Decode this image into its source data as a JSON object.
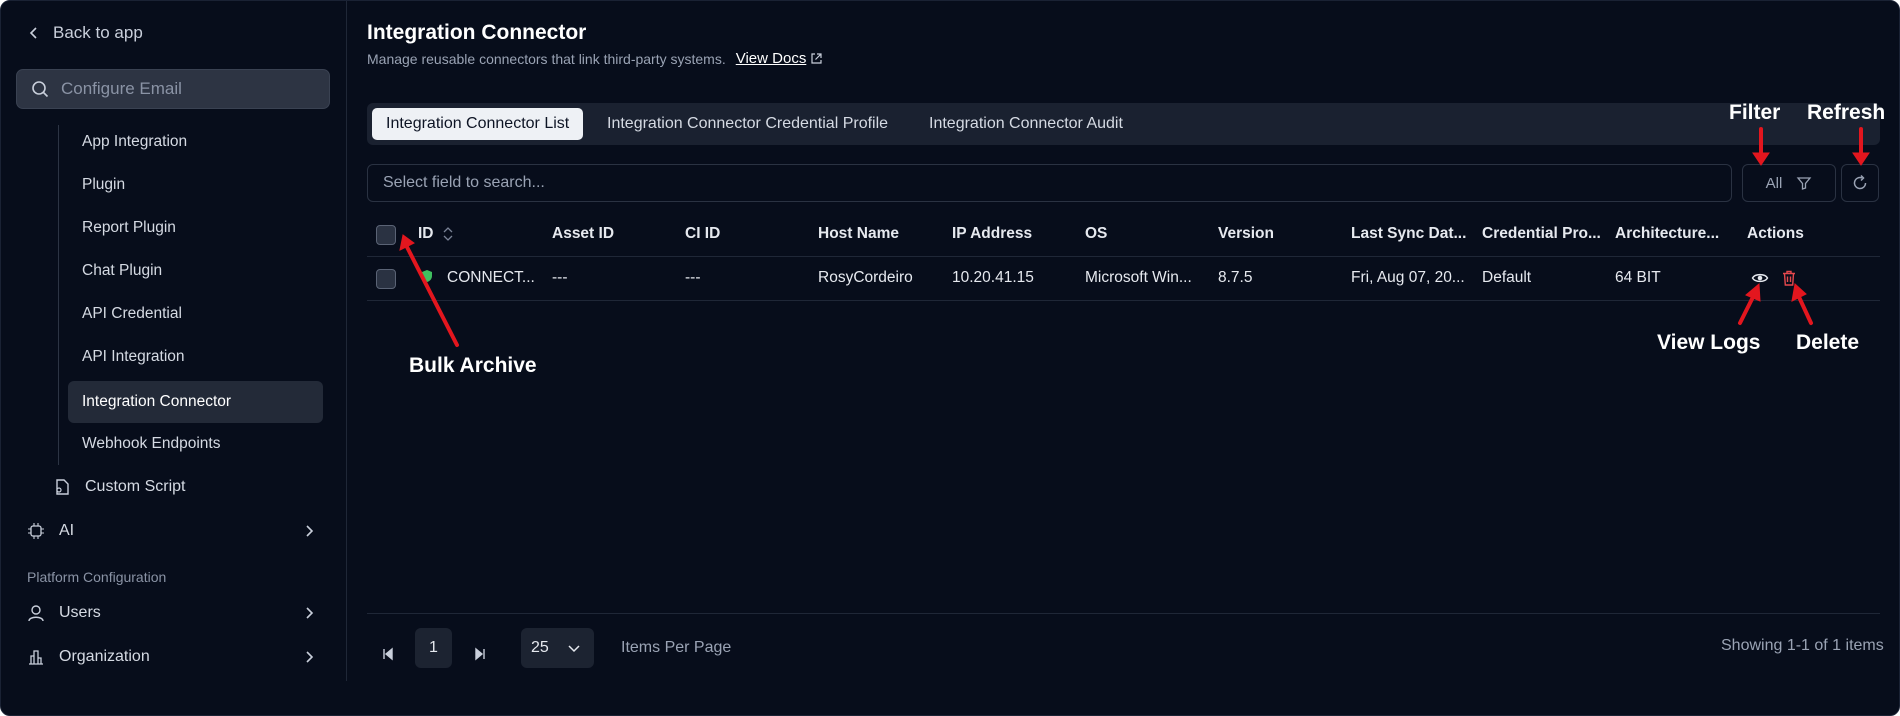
{
  "sidebar": {
    "back_label": "Back to app",
    "search_placeholder": "Configure Email",
    "sub_items": [
      "App Integration",
      "Plugin",
      "Report Plugin",
      "Chat Plugin",
      "API Credential",
      "API Integration",
      "Integration Connector",
      "Webhook Endpoints"
    ],
    "active_sub_item": "Integration Connector",
    "custom_script": "Custom Script",
    "ai": "AI",
    "section_label": "Platform Configuration",
    "users": "Users",
    "organization": "Organization"
  },
  "header": {
    "title": "Integration Connector",
    "subtitle": "Manage reusable connectors that link third-party systems.",
    "docs_link": "View Docs"
  },
  "tabs": [
    {
      "label": "Integration Connector List",
      "active": true
    },
    {
      "label": "Integration Connector Credential Profile",
      "active": false
    },
    {
      "label": "Integration Connector Audit",
      "active": false
    }
  ],
  "toolbar": {
    "search_placeholder": "Select field to search...",
    "filter_value": "All"
  },
  "table": {
    "columns": [
      "ID",
      "Asset ID",
      "CI ID",
      "Host Name",
      "IP Address",
      "OS",
      "Version",
      "Last Sync Dat...",
      "Credential Pro...",
      "Architecture...",
      "Actions"
    ],
    "rows": [
      {
        "id": "CONNECT...",
        "asset_id": "---",
        "ci_id": "---",
        "host_name": "RosyCordeiro",
        "ip_address": "10.20.41.15",
        "os": "Microsoft Win...",
        "version": "8.7.5",
        "last_sync": "Fri, Aug 07, 20...",
        "credential_profile": "Default",
        "architecture": "64 BIT",
        "status_color": "#3fbf5f"
      }
    ]
  },
  "pagination": {
    "current_page": "1",
    "per_page": "25",
    "items_per_page_label": "Items Per Page",
    "showing": "Showing 1-1 of 1 items"
  },
  "annotations": {
    "filter": "Filter",
    "refresh": "Refresh",
    "bulk_archive": "Bulk Archive",
    "view_logs": "View Logs",
    "delete": "Delete"
  },
  "colors": {
    "background": "#070d1b",
    "annotation_arrow": "#e3161e",
    "delete_icon": "#e5484d"
  }
}
